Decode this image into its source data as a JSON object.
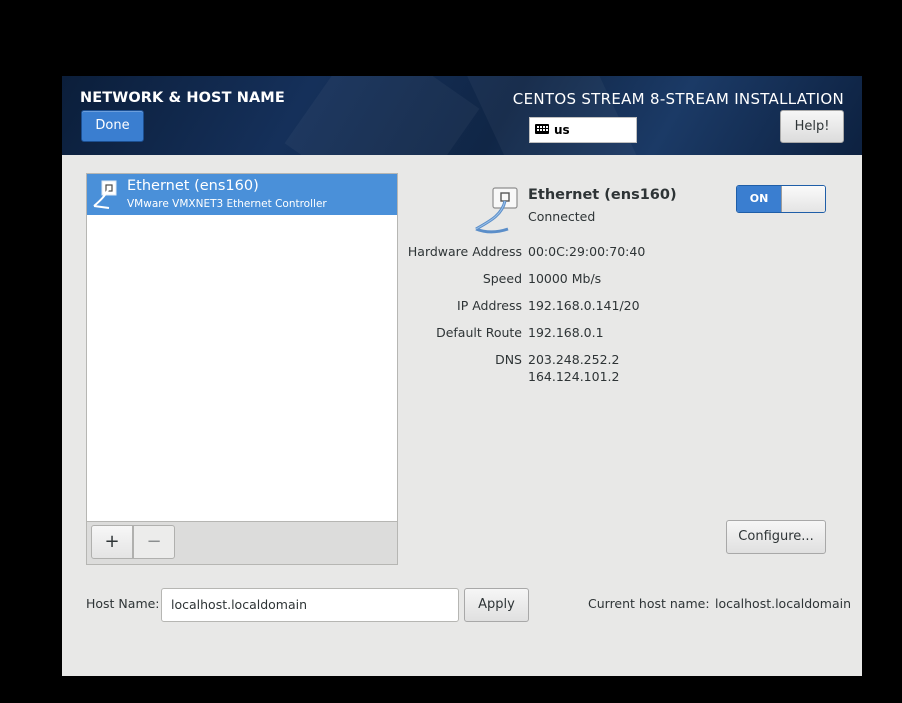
{
  "header": {
    "title": "NETWORK & HOST NAME",
    "product": "CENTOS STREAM 8-STREAM INSTALLATION",
    "done_label": "Done",
    "help_label": "Help!",
    "keyboard_layout": "us"
  },
  "device_list": {
    "items": [
      {
        "name": "Ethernet (ens160)",
        "description": "VMware VMXNET3 Ethernet Controller",
        "selected": true,
        "icon": "ethernet-icon"
      }
    ],
    "add_label": "+",
    "remove_label": "−"
  },
  "details": {
    "title": "Ethernet (ens160)",
    "status": "Connected",
    "toggle_label": "ON",
    "rows": [
      {
        "label": "Hardware Address",
        "value": "00:0C:29:00:70:40"
      },
      {
        "label": "Speed",
        "value": "10000 Mb/s"
      },
      {
        "label": "IP Address",
        "value": "192.168.0.141/20"
      },
      {
        "label": "Default Route",
        "value": "192.168.0.1"
      },
      {
        "label": "DNS",
        "value": "203.248.252.2",
        "value2": "164.124.101.2"
      }
    ],
    "configure_label": "Configure..."
  },
  "hostname": {
    "label": "Host Name:",
    "value": "localhost.localdomain",
    "apply_label": "Apply",
    "current_label": "Current host name:",
    "current_value": "localhost.localdomain"
  },
  "colors": {
    "accent": "#3a7ed0",
    "selection": "#4a90d9",
    "background": "#e8e8e7"
  }
}
